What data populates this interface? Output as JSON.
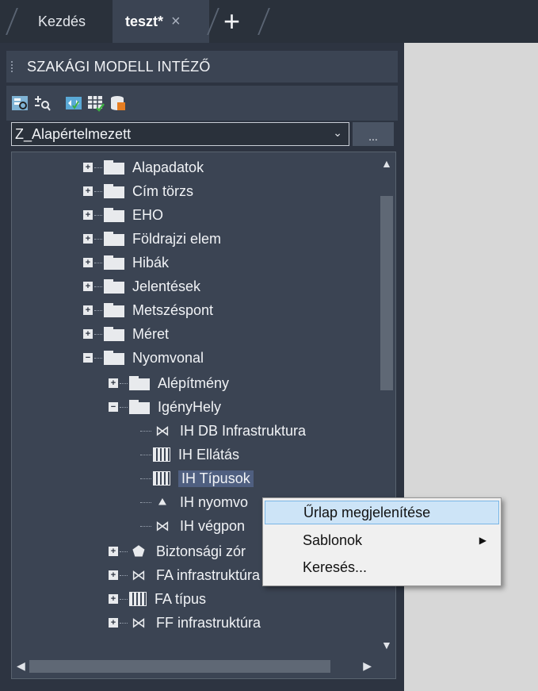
{
  "tabs": [
    {
      "label": "Kezdés"
    },
    {
      "label": "teszt*",
      "close": "×"
    }
  ],
  "tab_add": "+",
  "palette": {
    "title": "SZAKÁGI MODELL INTÉZŐ",
    "combo_value": "Z_Alapértelmezett",
    "more_button": "...",
    "toolbar_icons": [
      "model-explorer-icon",
      "search-nodes-icon",
      "connect-icon",
      "grid-check-icon",
      "database-icon"
    ]
  },
  "tree": {
    "items": [
      {
        "label": "Alapadatok"
      },
      {
        "label": "Cím törzs"
      },
      {
        "label": "EHO"
      },
      {
        "label": "Földrajzi elem"
      },
      {
        "label": "Hibák"
      },
      {
        "label": "Jelentések"
      },
      {
        "label": "Metszéspont"
      },
      {
        "label": "Méret"
      },
      {
        "label": "Nyomvonal"
      },
      {
        "label": "Alépítmény"
      },
      {
        "label": "IgényHely"
      },
      {
        "label": "IH DB Infrastruktura"
      },
      {
        "label": "IH Ellátás"
      },
      {
        "label": "IH Típusok"
      },
      {
        "label": "IH nyomvo"
      },
      {
        "label": "IH végpon"
      },
      {
        "label": "Biztonsági zór"
      },
      {
        "label": "FA infrastruktúra"
      },
      {
        "label": "FA típus"
      },
      {
        "label": "FF infrastruktúra"
      }
    ]
  },
  "context_menu": {
    "items": [
      {
        "label": "Űrlap megjelenítése"
      },
      {
        "label": "Sablonok"
      },
      {
        "label": "Keresés..."
      }
    ]
  },
  "colors": {
    "background": "#2d3441",
    "panel": "#3b4453",
    "selection": "#4f5f80",
    "menu_highlight": "#cde4f7"
  }
}
